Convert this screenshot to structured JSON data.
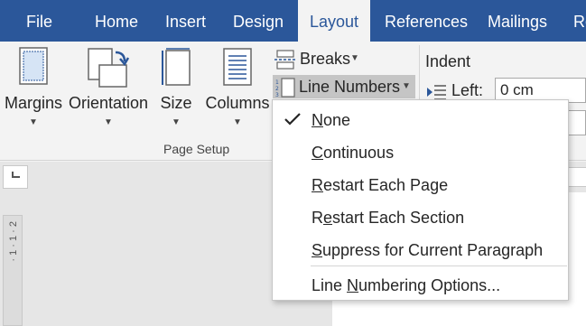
{
  "tabs": [
    {
      "label": "File"
    },
    {
      "label": "Home"
    },
    {
      "label": "Insert"
    },
    {
      "label": "Design"
    },
    {
      "label": "Layout",
      "active": true
    },
    {
      "label": "References"
    },
    {
      "label": "Mailings"
    },
    {
      "label": "Re"
    }
  ],
  "ribbon": {
    "margins_label": "Margins",
    "orientation_label": "Orientation",
    "size_label": "Size",
    "columns_label": "Columns",
    "breaks_label": "Breaks",
    "line_numbers_label": "Line Numbers",
    "page_setup_group": "Page Setup",
    "indent_title": "Indent",
    "indent_left_label": "Left:",
    "indent_left_value": "0 cm"
  },
  "vertical_ruler_text": "· 1 · 1 · 2",
  "line_numbers_menu": {
    "items": [
      {
        "pre": "",
        "key": "N",
        "post": "one",
        "checked": true
      },
      {
        "pre": "",
        "key": "C",
        "post": "ontinuous",
        "checked": false
      },
      {
        "pre": "",
        "key": "R",
        "post": "estart Each Page",
        "checked": false
      },
      {
        "pre": "R",
        "key": "e",
        "post": "start Each Section",
        "checked": false
      },
      {
        "pre": "",
        "key": "S",
        "post": "uppress for Current Paragraph",
        "checked": false
      },
      {
        "pre": "Line ",
        "key": "N",
        "post": "umbering Options...",
        "checked": false
      }
    ]
  },
  "colors": {
    "accent": "#2b579a",
    "ribbon_bg": "#f3f3f3",
    "pressed_bg": "#c5c5c5"
  },
  "icons": {
    "check": "checkmark-icon",
    "caret": "caret-down-icon"
  }
}
